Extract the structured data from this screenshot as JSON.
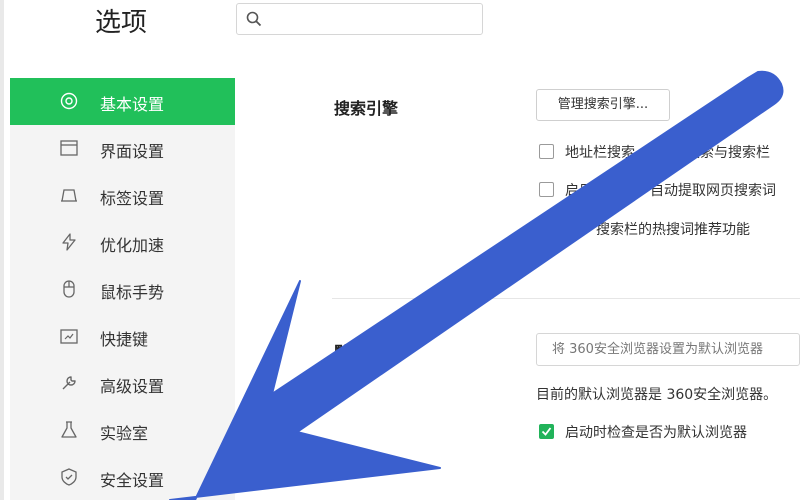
{
  "header": {
    "title": "选项",
    "search_placeholder": ""
  },
  "sidebar": {
    "items": [
      {
        "label": "基本设置",
        "icon": "settings-gear-icon",
        "active": true
      },
      {
        "label": "界面设置",
        "icon": "window-icon",
        "active": false
      },
      {
        "label": "标签设置",
        "icon": "tab-icon",
        "active": false
      },
      {
        "label": "优化加速",
        "icon": "lightning-icon",
        "active": false
      },
      {
        "label": "鼠标手势",
        "icon": "mouse-icon",
        "active": false
      },
      {
        "label": "快捷键",
        "icon": "keyboard-icon",
        "active": false
      },
      {
        "label": "高级设置",
        "icon": "wrench-icon",
        "active": false
      },
      {
        "label": "实验室",
        "icon": "flask-icon",
        "active": false
      },
      {
        "label": "安全设置",
        "icon": "shield-icon",
        "active": false
      }
    ],
    "active_color": "#21c05a"
  },
  "search_engine": {
    "label": "搜索引擎",
    "manage_button": "管理搜索引擎...",
    "options": [
      {
        "text": "地址栏搜索",
        "text_right": "搜索与搜索栏",
        "checked": false
      },
      {
        "text": "启用",
        "text_right": "自动提取网页搜索词",
        "checked": false
      },
      {
        "text": "搜索栏的热搜词推荐功能",
        "checked": true
      }
    ]
  },
  "default_browser": {
    "label": "默认浏览",
    "set_default_button": "将 360安全浏览器设置为默认浏览器",
    "status_text": "目前的默认浏览器是 360安全浏览器。",
    "check_option": {
      "text": "启动时检查是否为默认浏览器",
      "checked": true
    }
  },
  "overlay": {
    "arrow_color": "#3a5fce"
  }
}
